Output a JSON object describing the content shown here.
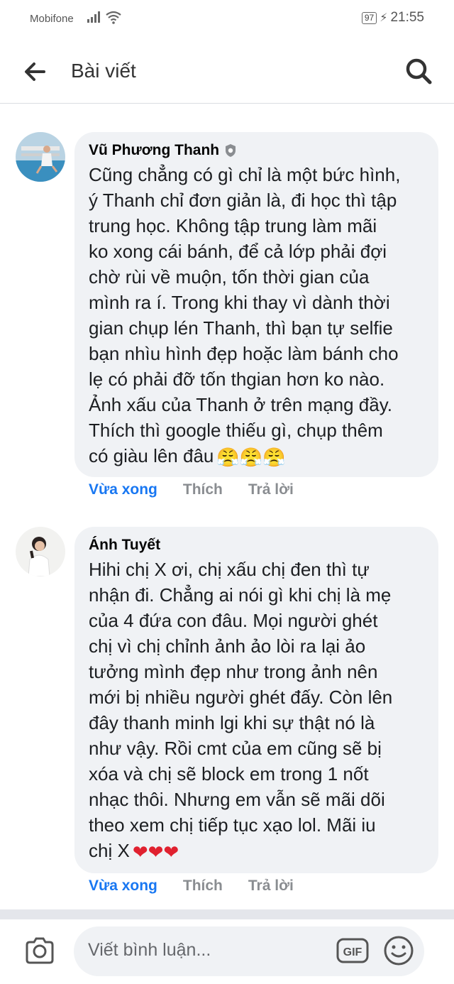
{
  "status_bar": {
    "carrier": "Mobifone",
    "battery": "97",
    "time": "21:55"
  },
  "header": {
    "title": "Bài viết"
  },
  "comments": [
    {
      "author": "Vũ Phương Thanh",
      "verified_icon": "shield-badge-icon",
      "text": "Cũng chẳng có gì chỉ là một bức hình,\ný Thanh chỉ đơn giản là, đi học thì tập\ntrung học. Không tập trung làm mãi\nko xong cái bánh, để cả lớp phải đợi\nchờ rùi về muộn, tốn thời gian của\nmình ra í. Trong khi thay vì dành thời\ngian chụp lén Thanh, thì bạn tự selfie\nbạn nhìu hình đẹp hoặc làm bánh cho\nlẹ có phải đỡ tốn thgian hơn ko nào.\nẢnh xấu của Thanh ở trên mạng đầy.\nThích thì google thiếu gì, chụp thêm\ncó giàu lên đâu",
      "emojis": "😤😤😤",
      "time": "Vừa xong",
      "like": "Thích",
      "reply": "Trả lời"
    },
    {
      "author": "Ánh Tuyết",
      "text": "Hihi chị X ơi, chị xấu chị đen thì tự\nnhận đi. Chẳng ai nói gì khi chị là mẹ\ncủa 4 đứa con đâu. Mọi người ghét\nchị vì chị chỉnh ảnh ảo lòi ra lại ảo\ntưởng mình đẹp như trong ảnh nên\nmới bị nhiều người ghét đấy. Còn lên\nđây thanh minh lgi khi sự thật nó là\nnhư vậy. Rồi cmt của em cũng sẽ bị\nxóa và chị sẽ block em trong 1 nốt\nnhạc thôi. Nhưng em vẫn sẽ mãi dõi\ntheo xem chị tiếp tục xạo lol. Mãi iu\nchị X",
      "emojis": "❤❤❤",
      "time": "Vừa xong",
      "like": "Thích",
      "reply": "Trả lời"
    }
  ],
  "composer": {
    "placeholder": "Viết bình luận...",
    "gif_label": "GIF"
  },
  "colors": {
    "accent": "#1877f2",
    "bubble": "#f0f2f5",
    "muted": "#8a8d91",
    "heart": "#e0212f"
  }
}
